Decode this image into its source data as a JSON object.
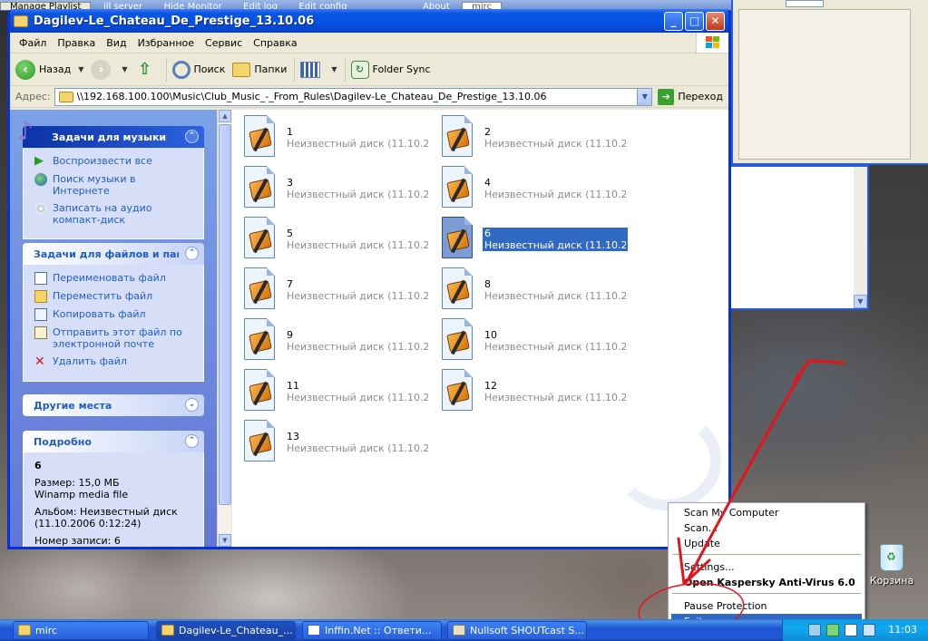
{
  "background": {
    "top_items": [
      "Manage Playlist",
      "ill server",
      "Hide Monitor",
      "Edit log",
      "Edit config",
      "About",
      "mirc"
    ]
  },
  "window": {
    "title": "Dagilev-Le_Chateau_De_Prestige_13.10.06",
    "menu": [
      "Файл",
      "Правка",
      "Вид",
      "Избранное",
      "Сервис",
      "Справка"
    ],
    "toolbar": {
      "back": "Назад",
      "search": "Поиск",
      "folders": "Папки",
      "folder_sync": "Folder Sync"
    },
    "address": {
      "label": "Адрес:",
      "value": "\\\\192.168.100.100\\Music\\Club_Music_-_From_Rules\\Dagilev-Le_Chateau_De_Prestige_13.10.06",
      "go": "Переход"
    }
  },
  "taskpane": {
    "music": {
      "title": "Задачи для музыки",
      "links": [
        "Воспроизвести все",
        "Поиск музыки в Интернете",
        "Записать на аудио компакт-диск"
      ]
    },
    "files": {
      "title": "Задачи для файлов и папок",
      "links": [
        "Переименовать файл",
        "Переместить файл",
        "Копировать файл",
        "Отправить этот файл по электронной почте",
        "Удалить файл"
      ]
    },
    "other": {
      "title": "Другие места"
    },
    "details": {
      "title": "Подробно",
      "name": "6",
      "size": "Размер: 15,0 МБ",
      "type": "Winamp media file",
      "album": "Альбом: Неизвестный диск (11.10.2006 0:12:24)",
      "track": "Номер записи: 6"
    }
  },
  "files": [
    {
      "name": "1",
      "sub": "Неизвестный диск (11.10.20..."
    },
    {
      "name": "2",
      "sub": "Неизвестный диск (11.10.20..."
    },
    {
      "name": "3",
      "sub": "Неизвестный диск (11.10.20..."
    },
    {
      "name": "4",
      "sub": "Неизвестный диск (11.10.20..."
    },
    {
      "name": "5",
      "sub": "Неизвестный диск (11.10.20..."
    },
    {
      "name": "6",
      "sub": "Неизвестный диск (11.10.20...",
      "selected": true
    },
    {
      "name": "7",
      "sub": "Неизвестный диск (11.10.20..."
    },
    {
      "name": "8",
      "sub": "Неизвестный диск (11.10.20..."
    },
    {
      "name": "9",
      "sub": "Неизвестный диск (11.10.20..."
    },
    {
      "name": "10",
      "sub": "Неизвестный диск (11.10.20..."
    },
    {
      "name": "11",
      "sub": "Неизвестный диск (11.10.20..."
    },
    {
      "name": "12",
      "sub": "Неизвестный диск (11.10.20..."
    },
    {
      "name": "13",
      "sub": "Неизвестный диск (11.10.20..."
    }
  ],
  "context_menu": {
    "items": [
      "Scan My Computer",
      "Scan...",
      "Update",
      "Settings...",
      "Open Kaspersky Anti-Virus 6.0",
      "Pause Protection",
      "Exit"
    ],
    "highlighted": "Exit"
  },
  "desktop": {
    "recycle_bin": "Корзина"
  },
  "taskbar": {
    "tasks": [
      "mirc",
      "Dagilev-Le_Chateau_...",
      "Inffin.Net :: Ответи...",
      "Nullsoft SHOUTcast S..."
    ],
    "clock": "11:03"
  },
  "colors": {
    "annotation": "#e8121b",
    "selection": "#316ac5",
    "titlebar": "#0551e2"
  }
}
